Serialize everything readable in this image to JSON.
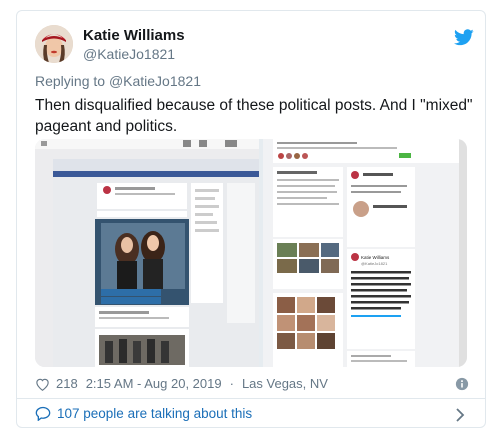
{
  "author": {
    "name": "Katie Williams",
    "handle": "@KatieJo1821"
  },
  "reply": {
    "prefix": "Replying to",
    "mention": "@KatieJo1821"
  },
  "tweet_text": "Then disqualified because of these political posts.  And I \"mixed\" pageant and politics.",
  "embedded": {
    "left_hashtags": [
      "#missamerica2019",
      "#missnevadastate"
    ],
    "right_profile_name": "Katie Williams",
    "right_profile_handle": "@KatieJo1821",
    "right_post_text": "Antifa is a Terrorist Organization. Period! If you support their cause, you are undoubtedly Anti-American. The people of Portland need to take back their city from this group of entitled children with daddy issues.",
    "right_timestamp": "8:56 PM · 17 Aug 19 from Las Vegas, NV"
  },
  "meta": {
    "likes": "218",
    "time": "2:15 AM - Aug 20, 2019",
    "location": "Las Vegas, NV"
  },
  "footer": {
    "talking": "107 people are talking about this"
  },
  "colors": {
    "twitter_blue": "#1da1f2",
    "link_blue": "#1b6fb8",
    "meta_gray": "#657786"
  },
  "icons": [
    "twitter-bird-icon",
    "heart-icon",
    "info-icon",
    "speech-bubble-icon",
    "chevron-right-icon"
  ]
}
